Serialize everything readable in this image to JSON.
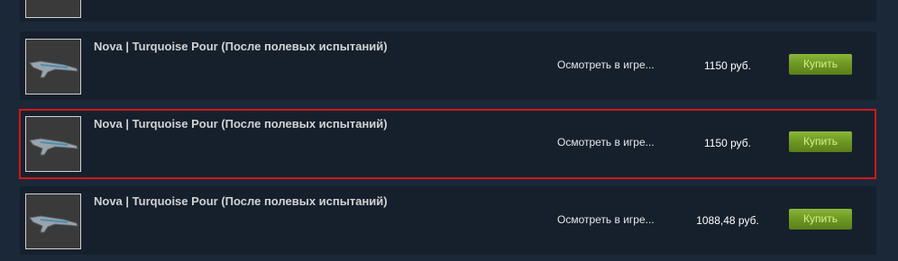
{
  "listings": [
    {
      "name": "",
      "inspect_label": "",
      "price": "",
      "buy_label": ""
    },
    {
      "name": "Nova | Turquoise Pour (После полевых испытаний)",
      "inspect_label": "Осмотреть в игре...",
      "price": "1150 руб.",
      "buy_label": "Купить"
    },
    {
      "name": "Nova | Turquoise Pour (После полевых испытаний)",
      "inspect_label": "Осмотреть в игре...",
      "price": "1150 руб.",
      "buy_label": "Купить"
    },
    {
      "name": "Nova | Turquoise Pour (После полевых испытаний)",
      "inspect_label": "Осмотреть в игре...",
      "price": "1088,48 руб.",
      "buy_label": "Купить"
    }
  ],
  "highlighted_listing": 2,
  "colors": {
    "page_background": "#1b2838",
    "row_background": "#16202d",
    "buy_button": "#75a127",
    "highlight_border": "#d01818"
  }
}
